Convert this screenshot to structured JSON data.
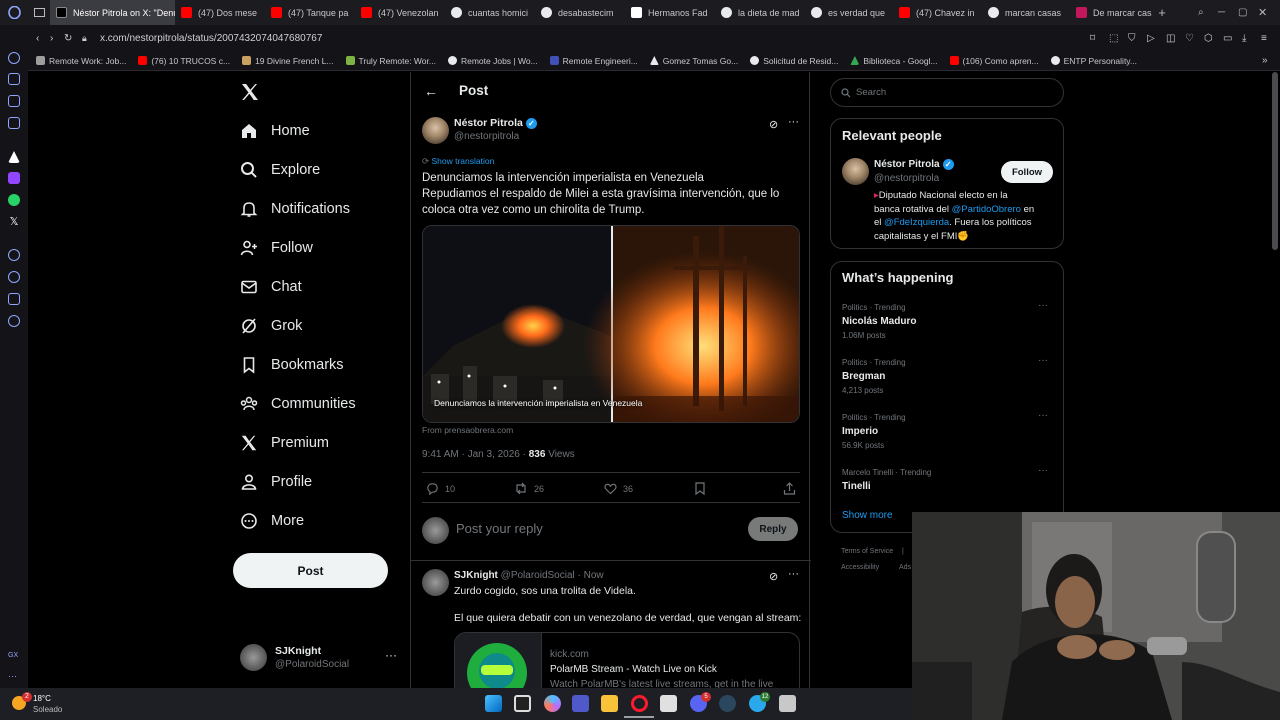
{
  "tabs": [
    {
      "label": "Néstor Pitrola on X: \"Denu",
      "color": "#ffffff",
      "active": true
    },
    {
      "label": "(47) Dos mese",
      "color": "#ff0000"
    },
    {
      "label": "(47) Tanque pa",
      "color": "#ff0000"
    },
    {
      "label": "(47) Venezolan",
      "color": "#ff0000"
    },
    {
      "label": "cuantas homici",
      "color": "#e8eaed"
    },
    {
      "label": "desabastecim",
      "color": "#e8eaed"
    },
    {
      "label": "Hermanos Fad",
      "color": "#ffffff"
    },
    {
      "label": "la dieta de mad",
      "color": "#e8eaed"
    },
    {
      "label": "es verdad que",
      "color": "#e8eaed"
    },
    {
      "label": "(47) Chavez in",
      "color": "#ff0000"
    },
    {
      "label": "marcan casas",
      "color": "#e8eaed"
    },
    {
      "label": "De marcar casa",
      "color": "#c2185b"
    }
  ],
  "address": {
    "url": "x.com/nestorpitrola/status/2007432074047680767"
  },
  "bookmarks": [
    {
      "label": "Remote Work: Job...",
      "color": "#9e9e9e"
    },
    {
      "label": "(76) 10 TRUCOS c...",
      "color": "#ff0000"
    },
    {
      "label": "19 Divine French L...",
      "color": "#c8a060"
    },
    {
      "label": "Truly Remote: Wor...",
      "color": "#7cb342"
    },
    {
      "label": "Remote Jobs | Wo...",
      "color": "#e8eaed"
    },
    {
      "label": "Remote Engineeri...",
      "color": "#3f51b5"
    },
    {
      "label": "Gomez Tomas Go...",
      "color": "#e8eaed"
    },
    {
      "label": "Solicitud de Resid...",
      "color": "#e8eaed"
    },
    {
      "label": "Biblioteca - Googl...",
      "color": "#34a853"
    },
    {
      "label": "(106) Como apren...",
      "color": "#ff0000"
    },
    {
      "label": "ENTP Personality...",
      "color": "#e8eaed"
    }
  ],
  "nav": {
    "home": "Home",
    "explore": "Explore",
    "notifications": "Notifications",
    "follow": "Follow",
    "chat": "Chat",
    "grok": "Grok",
    "bookmarks": "Bookmarks",
    "communities": "Communities",
    "premium": "Premium",
    "profile": "Profile",
    "more": "More",
    "post_button": "Post"
  },
  "account": {
    "name": "SJKnight",
    "handle": "@PolaroidSocial"
  },
  "header": {
    "title": "Post"
  },
  "post": {
    "author": "Néstor Pitrola",
    "handle": "@nestorpitrola",
    "translate": "Show translation",
    "line1": "Denunciamos la intervención imperialista en Venezuela",
    "line2": "Repudiamos el respaldo de Milei a esta gravísima intervención, que lo coloca otra vez como un chirolita de Trump.",
    "media_caption": "Denunciamos la intervención imperialista en Venezuela",
    "source": "From prensaobrera.com",
    "time": "9:41 AM · Jan 3, 2026 · ",
    "views_count": "836",
    "views_label": " Views",
    "replies": "10",
    "reposts": "26",
    "likes": "36"
  },
  "reply_box": {
    "placeholder": "Post your reply",
    "button": "Reply"
  },
  "reply": {
    "author": "SJKnight",
    "handle": "@PolaroidSocial · Now",
    "text1": "Zurdo cogido, sos una trolita de Videla.",
    "text2": "El que quiera debatir con un venezolano de verdad, que vengan al stream:",
    "link_domain": "kick.com",
    "link_title": "PolarMB Stream - Watch Live on Kick",
    "link_desc": "Watch PolarMB's latest live streams, get in the live"
  },
  "search": {
    "placeholder": "Search"
  },
  "relevant": {
    "title": "Relevant people",
    "name": "Néstor Pitrola",
    "handle": "@nestorpitrola",
    "follow": "Follow",
    "bio1": "Diputado Nacional electo en la",
    "bio2": "banca rotativa del ",
    "bio_mention1": "@PartidoObrero",
    "bio3": " en",
    "bio4": "el ",
    "bio_mention2": "@FdeIzquierda",
    "bio5": ". Fuera los políticos",
    "bio6": "capitalistas y el FMI"
  },
  "happening": {
    "title": "What’s happening",
    "items": [
      {
        "meta": "Politics · Trending",
        "topic": "Nicolás Maduro",
        "count": "1.06M posts"
      },
      {
        "meta": "Politics · Trending",
        "topic": "Bregman",
        "count": "4,213 posts"
      },
      {
        "meta": "Politics · Trending",
        "topic": "Imperio",
        "count": "56.9K posts"
      },
      {
        "meta": "Marcelo Tinelli · Trending",
        "topic": "Tinelli",
        "count": ""
      }
    ],
    "show_more": "Show more"
  },
  "footer": {
    "terms": "Terms of Service",
    "accessibility": "Accessibility",
    "ads": "Ads"
  },
  "weather": {
    "temp": "18°C",
    "cond": "Soleado",
    "badge": "2"
  },
  "taskbar_badges": {
    "discord": "5",
    "telegram": "12"
  }
}
